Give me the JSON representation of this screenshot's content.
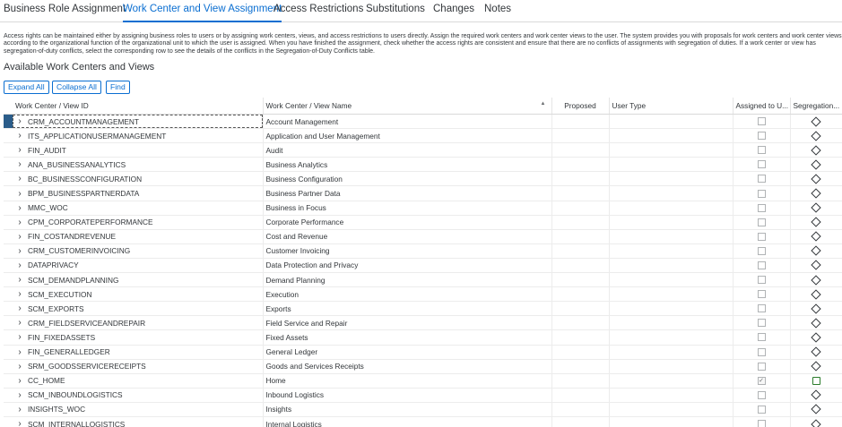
{
  "tabs": [
    {
      "label": "Business Role Assignment",
      "active": false
    },
    {
      "label": "Work Center and View Assignment",
      "active": true
    },
    {
      "label": "Access Restrictions",
      "active": false
    },
    {
      "label": "Substitutions",
      "active": false
    },
    {
      "label": "Changes",
      "active": false
    },
    {
      "label": "Notes",
      "active": false
    }
  ],
  "description": "Access rights can be maintained either by assigning business roles to users or by assigning work centers, views, and access restrictions to users directly. Assign the required work centers and work center views to the user. The system provides you with proposals for work centers and work center views according to the organizational function of the organizational unit to which the user is assigned. When you have finished the assignment, check whether the access rights are consistent and ensure that there are no conflicts of assignments with segregation of duties. If a work center or view has segregation-of-duty conflicts, select the corresponding row to see the details of the conflicts in the Segregation-of-Duty Conflicts table.",
  "section_title": "Available Work Centers and Views",
  "toolbar": {
    "expand_all": "Expand All",
    "collapse_all": "Collapse All",
    "find": "Find"
  },
  "columns": {
    "id": "Work Center / View ID",
    "name": "Work Center / View Name",
    "proposed": "Proposed",
    "user_type": "User Type",
    "assigned": "Assigned to U...",
    "segregation": "Segregation..."
  },
  "colors": {
    "accent": "#0a6ed1",
    "selected_row_marker": "#2b5d8a",
    "conflict_ok": "#2b7c2b"
  },
  "rows": [
    {
      "id": "CRM_ACCOUNTMANAGEMENT",
      "name": "Account Management",
      "assigned": false,
      "sod": "diamond",
      "selected": true
    },
    {
      "id": "ITS_APPLICATIONUSERMANAGEMENT",
      "name": "Application and User Management",
      "assigned": false,
      "sod": "diamond"
    },
    {
      "id": "FIN_AUDIT",
      "name": "Audit",
      "assigned": false,
      "sod": "diamond"
    },
    {
      "id": "ANA_BUSINESSANALYTICS",
      "name": "Business Analytics",
      "assigned": false,
      "sod": "diamond"
    },
    {
      "id": "BC_BUSINESSCONFIGURATION",
      "name": "Business Configuration",
      "assigned": false,
      "sod": "diamond"
    },
    {
      "id": "BPM_BUSINESSPARTNERDATA",
      "name": "Business Partner Data",
      "assigned": false,
      "sod": "diamond"
    },
    {
      "id": "MMC_WOC",
      "name": "Business in Focus",
      "assigned": false,
      "sod": "diamond"
    },
    {
      "id": "CPM_CORPORATEPERFORMANCE",
      "name": "Corporate Performance",
      "assigned": false,
      "sod": "diamond"
    },
    {
      "id": "FIN_COSTANDREVENUE",
      "name": "Cost and Revenue",
      "assigned": false,
      "sod": "diamond"
    },
    {
      "id": "CRM_CUSTOMERINVOICING",
      "name": "Customer Invoicing",
      "assigned": false,
      "sod": "diamond"
    },
    {
      "id": "DATAPRIVACY",
      "name": "Data Protection and Privacy",
      "assigned": false,
      "sod": "diamond"
    },
    {
      "id": "SCM_DEMANDPLANNING",
      "name": "Demand Planning",
      "assigned": false,
      "sod": "diamond"
    },
    {
      "id": "SCM_EXECUTION",
      "name": "Execution",
      "assigned": false,
      "sod": "diamond"
    },
    {
      "id": "SCM_EXPORTS",
      "name": "Exports",
      "assigned": false,
      "sod": "diamond"
    },
    {
      "id": "CRM_FIELDSERVICEANDREPAIR",
      "name": "Field Service and Repair",
      "assigned": false,
      "sod": "diamond"
    },
    {
      "id": "FIN_FIXEDASSETS",
      "name": "Fixed Assets",
      "assigned": false,
      "sod": "diamond"
    },
    {
      "id": "FIN_GENERALLEDGER",
      "name": "General Ledger",
      "assigned": false,
      "sod": "diamond"
    },
    {
      "id": "SRM_GOODSSERVICERECEIPTS",
      "name": "Goods and Services Receipts",
      "assigned": false,
      "sod": "diamond"
    },
    {
      "id": "CC_HOME",
      "name": "Home",
      "assigned": true,
      "sod": "green"
    },
    {
      "id": "SCM_INBOUNDLOGISTICS",
      "name": "Inbound Logistics",
      "assigned": false,
      "sod": "diamond"
    },
    {
      "id": "INSIGHTS_WOC",
      "name": "Insights",
      "assigned": false,
      "sod": "diamond"
    },
    {
      "id": "SCM_INTERNALLOGISTICS",
      "name": "Internal Logistics",
      "assigned": false,
      "sod": "diamond"
    }
  ]
}
